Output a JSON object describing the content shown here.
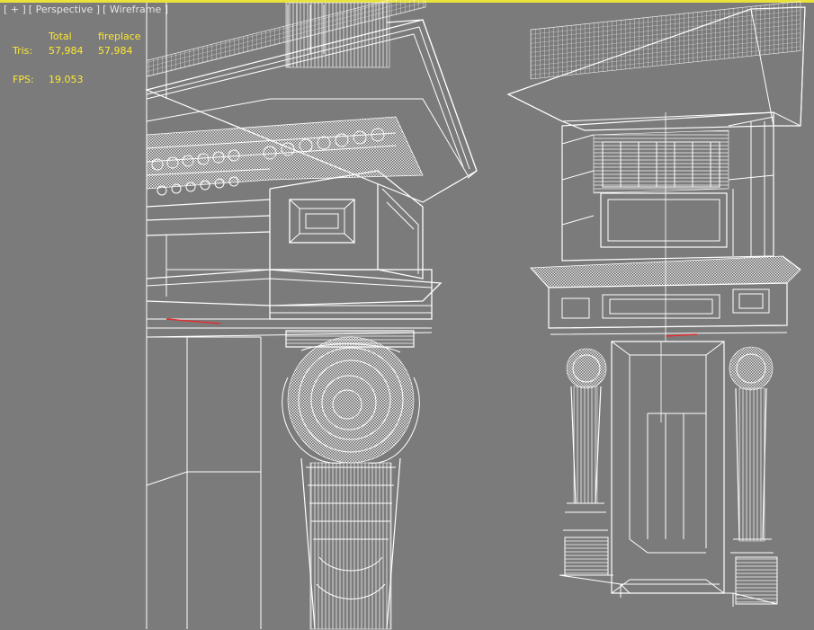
{
  "viewport": {
    "menu_plus": "[ + ]",
    "view_name": "[ Perspective ]",
    "shading_mode": "[ Wireframe ]",
    "active_border_color": "#e8e23a",
    "background_color": "#7b7b7b"
  },
  "stats": {
    "col_total": "Total",
    "col_object": "fireplace",
    "tris_label": "Tris:",
    "tris_total": "57,984",
    "tris_object": "57,984",
    "fps_label": "FPS:",
    "fps_value": "19.053",
    "text_color": "#ffe833"
  },
  "scene": {
    "object_name": "fireplace",
    "shading": "wireframe",
    "wire_color": "#ffffff"
  }
}
